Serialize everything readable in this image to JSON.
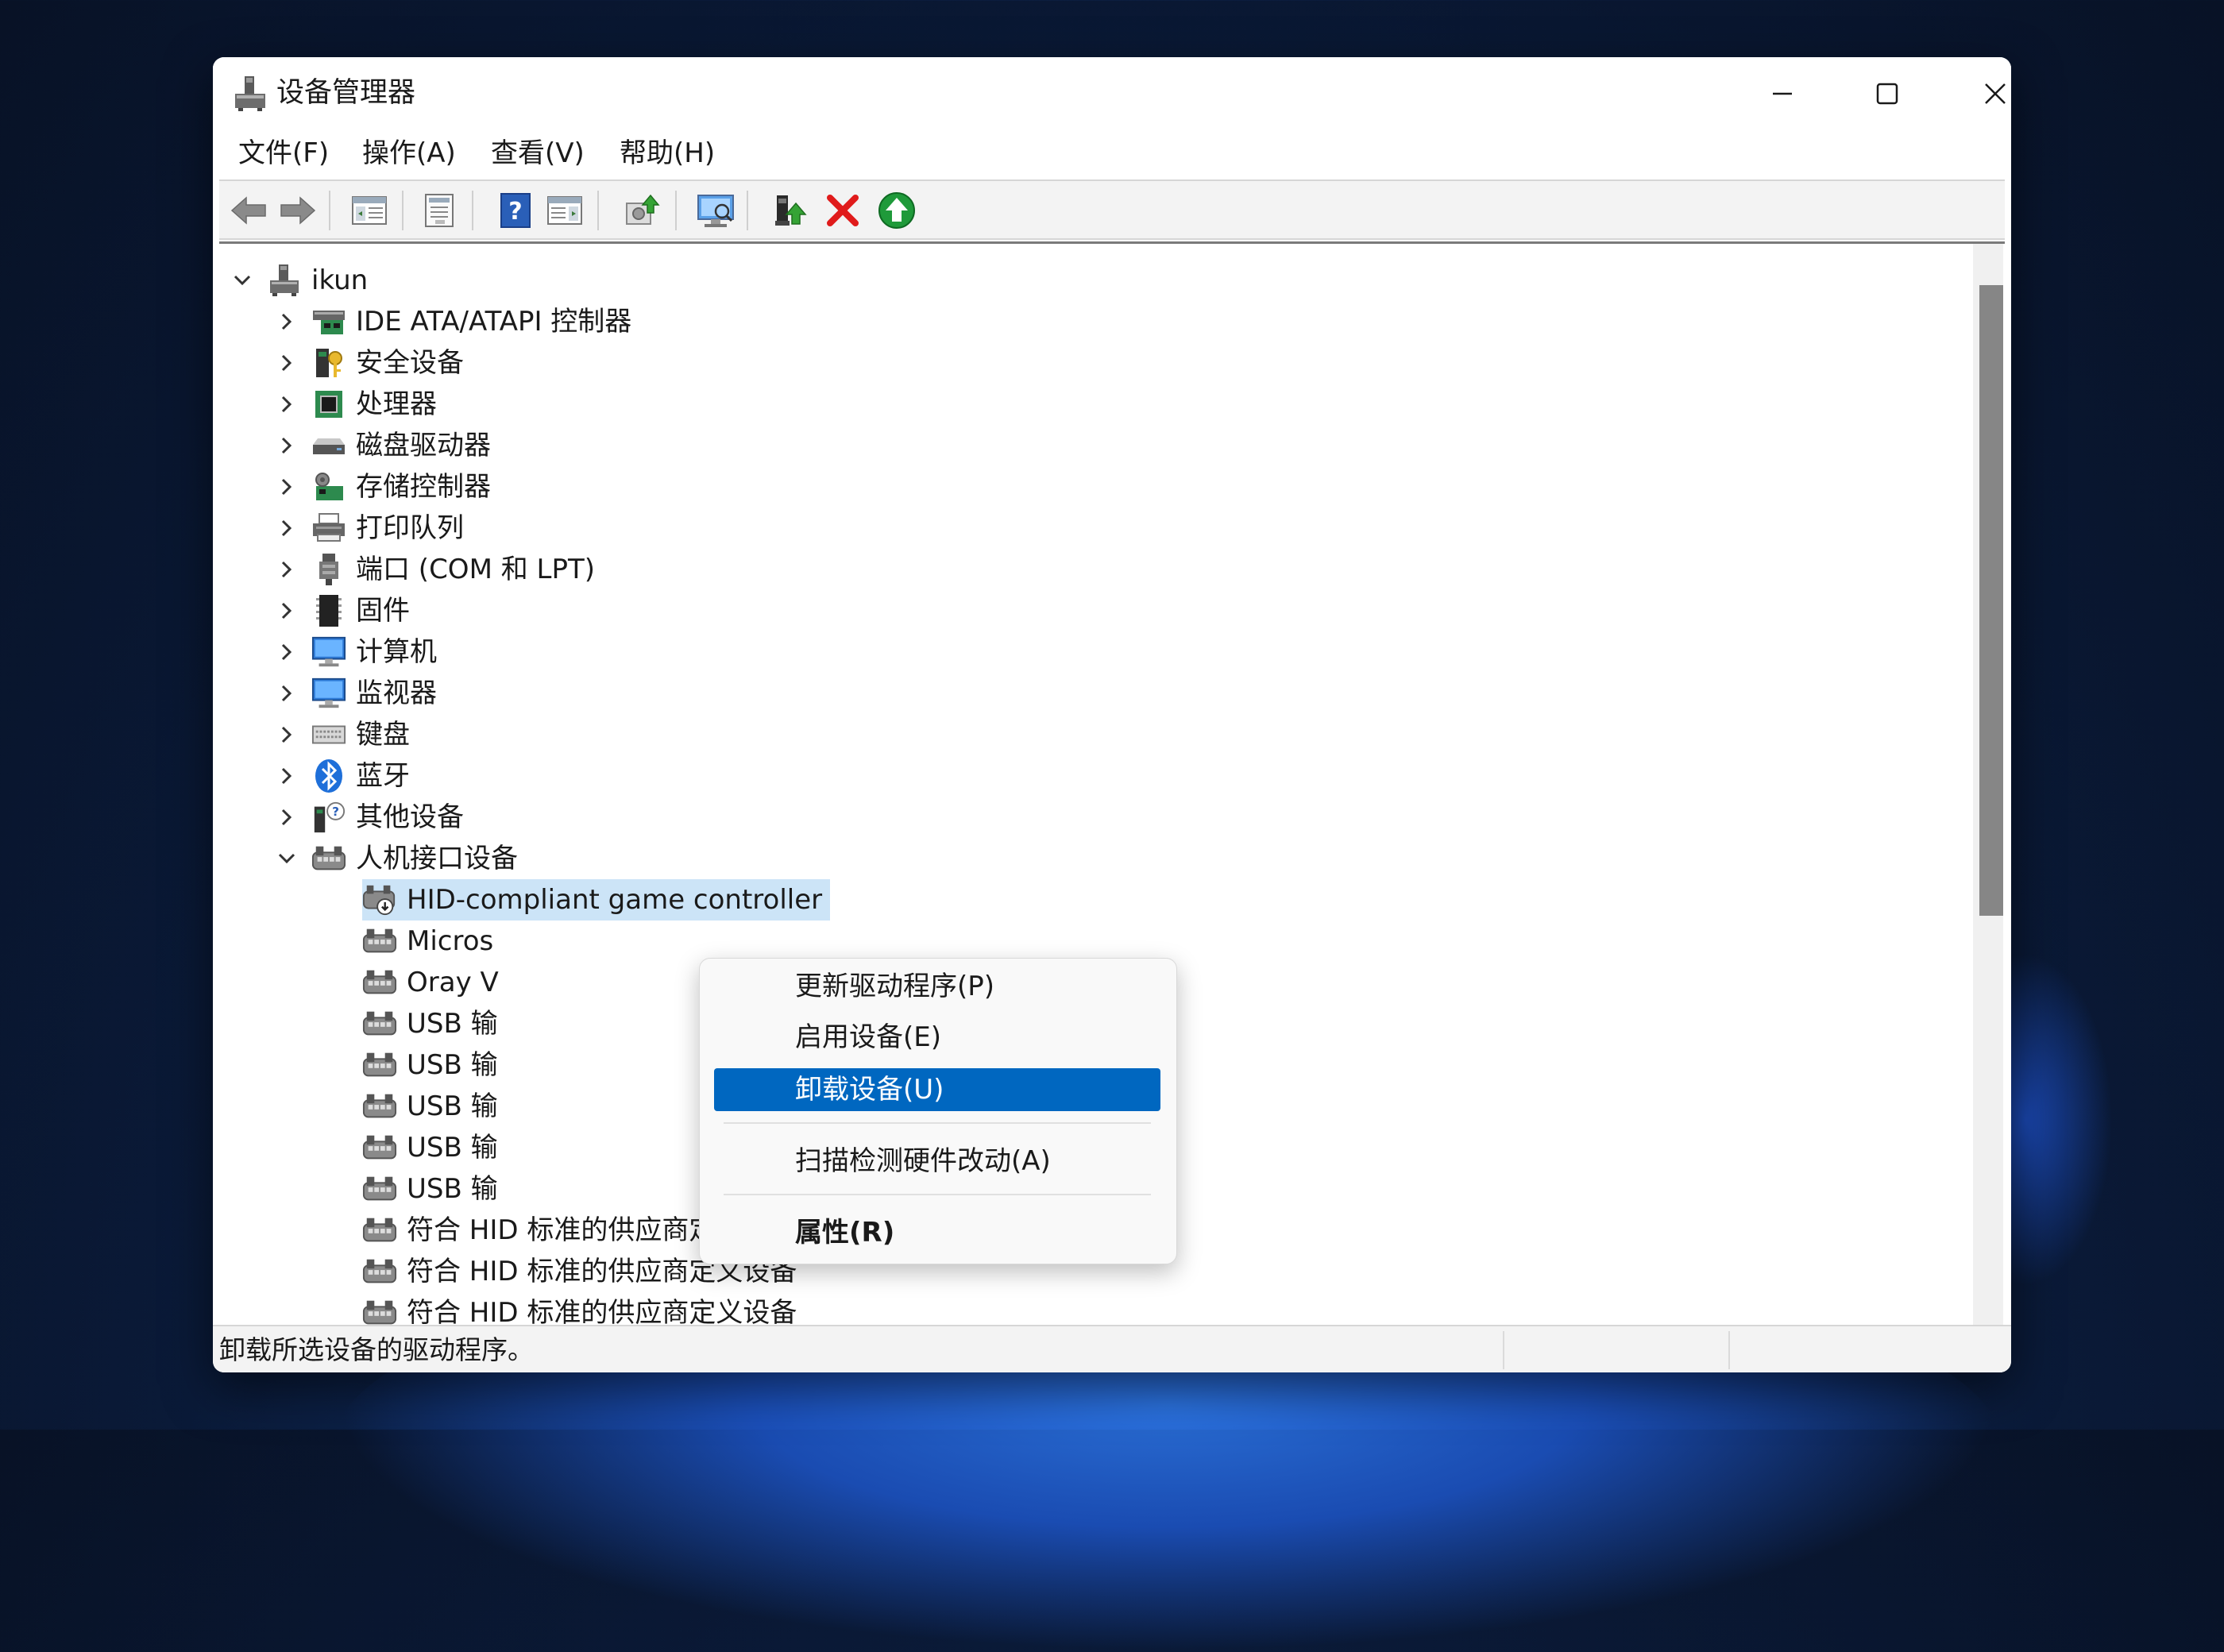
{
  "window": {
    "title": "设备管理器"
  },
  "menubar": [
    {
      "label": "文件(F)"
    },
    {
      "label": "操作(A)"
    },
    {
      "label": "查看(V)"
    },
    {
      "label": "帮助(H)"
    }
  ],
  "toolbar": {
    "buttons": [
      "back-arrow-icon",
      "forward-arrow-icon",
      "show-hide-console-tree-icon",
      "properties-icon",
      "help-icon",
      "action-pane-icon",
      "update-driver-icon",
      "scan-hardware-icon",
      "enable-device-icon",
      "uninstall-device-icon",
      "add-legacy-hardware-icon"
    ]
  },
  "tree": {
    "root": "ikun",
    "categories": [
      {
        "label": "IDE ATA/ATAPI 控制器",
        "icon": "ide-controller-icon"
      },
      {
        "label": "安全设备",
        "icon": "security-device-icon"
      },
      {
        "label": "处理器",
        "icon": "processor-icon"
      },
      {
        "label": "磁盘驱动器",
        "icon": "disk-drive-icon"
      },
      {
        "label": "存储控制器",
        "icon": "storage-controller-icon"
      },
      {
        "label": "打印队列",
        "icon": "printer-icon"
      },
      {
        "label": "端口 (COM 和 LPT)",
        "icon": "port-icon"
      },
      {
        "label": "固件",
        "icon": "firmware-icon"
      },
      {
        "label": "计算机",
        "icon": "computer-icon"
      },
      {
        "label": "监视器",
        "icon": "monitor-icon"
      },
      {
        "label": "键盘",
        "icon": "keyboard-icon"
      },
      {
        "label": "蓝牙",
        "icon": "bluetooth-icon"
      },
      {
        "label": "其他设备",
        "icon": "other-device-icon"
      },
      {
        "label": "人机接口设备",
        "icon": "hid-icon"
      }
    ],
    "hid_children": [
      "HID-compliant game controller",
      "Micros",
      "Oray V",
      "USB 输",
      "USB 输",
      "USB 输",
      "USB 输",
      "USB 输",
      "符合 HID 标准的供应商定义设备",
      "符合 HID 标准的供应商定义设备",
      "符合 HID 标准的供应商定义设备"
    ]
  },
  "context_menu": {
    "items": [
      {
        "label": "更新驱动程序(P)"
      },
      {
        "label": "启用设备(E)"
      },
      {
        "label": "卸载设备(U)",
        "highlighted": true
      },
      {
        "label": "扫描检测硬件改动(A)"
      },
      {
        "label": "属性(R)",
        "bold": true
      }
    ]
  },
  "statusbar": {
    "text": "卸载所选设备的驱动程序。"
  },
  "colors": {
    "selection": "#cce4f7",
    "menu_highlight": "#0067c0",
    "accent": "#0067c0"
  }
}
